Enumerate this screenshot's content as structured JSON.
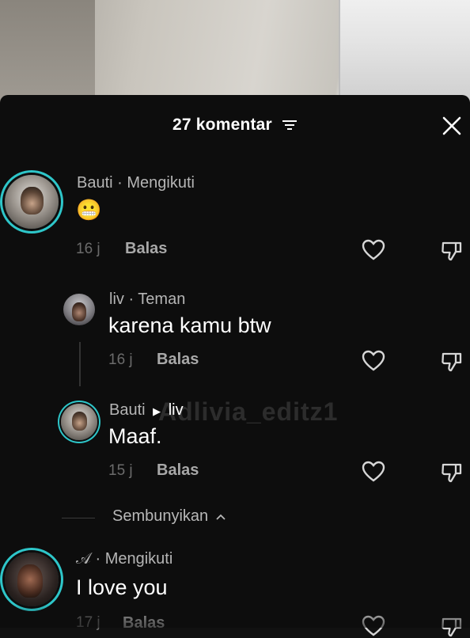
{
  "header": {
    "title": "27 komentar",
    "icons": {
      "sort": "sort-lines-icon",
      "close": "close-x-icon"
    }
  },
  "watermark": "Adlivia_editz1",
  "comments": [
    {
      "username": "Bauti · Mengikuti",
      "text": "😬",
      "time": "16 j",
      "reply_label": "Balas"
    },
    {
      "username": "liv · Teman",
      "text": "karena kamu btw",
      "time": "16 j",
      "reply_label": "Balas"
    },
    {
      "username_from": "Bauti",
      "username_to": "liv",
      "text": "Maaf.",
      "time": "15 j",
      "reply_label": "Balas"
    },
    {
      "username": "𝒜 · Mengikuti",
      "text": "I love you",
      "time": "17 j",
      "reply_label": "Balas"
    }
  ],
  "hide_replies_label": "Sembunyikan",
  "colors": {
    "sheet_bg": "#0d0d0d",
    "ring": "#2ec6c9",
    "muted_text": "#b5b5b5"
  }
}
